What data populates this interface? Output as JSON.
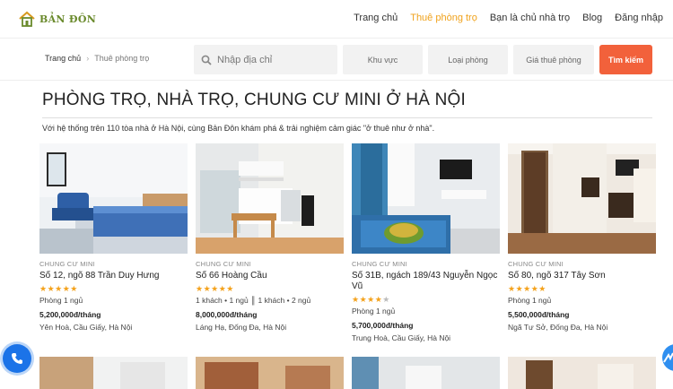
{
  "header": {
    "logo_text": "BẢN ĐÔN",
    "nav": [
      {
        "label": "Trang chủ",
        "active": false
      },
      {
        "label": "Thuê phòng trọ",
        "active": true
      },
      {
        "label": "Bạn là chủ nhà trọ",
        "active": false
      },
      {
        "label": "Blog",
        "active": false
      },
      {
        "label": "Đăng nhập",
        "active": false
      }
    ]
  },
  "breadcrumb": {
    "home": "Trang chủ",
    "current": "Thuê phòng trọ"
  },
  "search": {
    "placeholder": "Nhập địa chỉ",
    "area": "Khu vực",
    "type": "Loại phòng",
    "price": "Giá thuê phòng",
    "button": "Tìm kiếm"
  },
  "page": {
    "title": "PHÒNG TRỌ, NHÀ TRỌ, CHUNG CƯ MINI Ở HÀ NỘI",
    "intro": "Với hệ thống trên 110 tòa nhà ở Hà Nội, cùng Bản Đôn khám phá & trải nghiệm cảm giác \"ở thuê như ở nhà\"."
  },
  "listings": [
    {
      "category": "CHUNG CƯ MINI",
      "name": "Số 12, ngõ 88 Trần Duy Hưng",
      "rating": 5,
      "rooms": "Phòng 1 ngủ",
      "price": "5,200,000đ/tháng",
      "address": "Yên Hoà, Cầu Giấy, Hà Nội"
    },
    {
      "category": "CHUNG CƯ MINI",
      "name": "Số 66 Hoàng Cầu",
      "rating": 5,
      "rooms": "1 khách • 1 ngủ ║ 1 khách • 2 ngủ",
      "price": "8,000,000đ/tháng",
      "address": "Láng Hạ, Đống Đa, Hà Nội"
    },
    {
      "category": "CHUNG CƯ MINI",
      "name": "Số 31B, ngách 189/43 Nguyễn Ngọc Vũ",
      "rating": 4,
      "rooms": "Phòng 1 ngủ",
      "price": "5,700,000đ/tháng",
      "address": "Trung Hoà, Cầu Giấy, Hà Nội"
    },
    {
      "category": "CHUNG CƯ MINI",
      "name": "Số 80, ngõ 317 Tây Sơn",
      "rating": 5,
      "rooms": "Phòng 1 ngủ",
      "price": "5,500,000đ/tháng",
      "address": "Ngã Tư Sở, Đống Đa, Hà Nội"
    }
  ],
  "colors": {
    "accent": "#f0a21c",
    "button": "#f2613b",
    "brand": "#6a8a2c",
    "star": "#f4a21c"
  }
}
